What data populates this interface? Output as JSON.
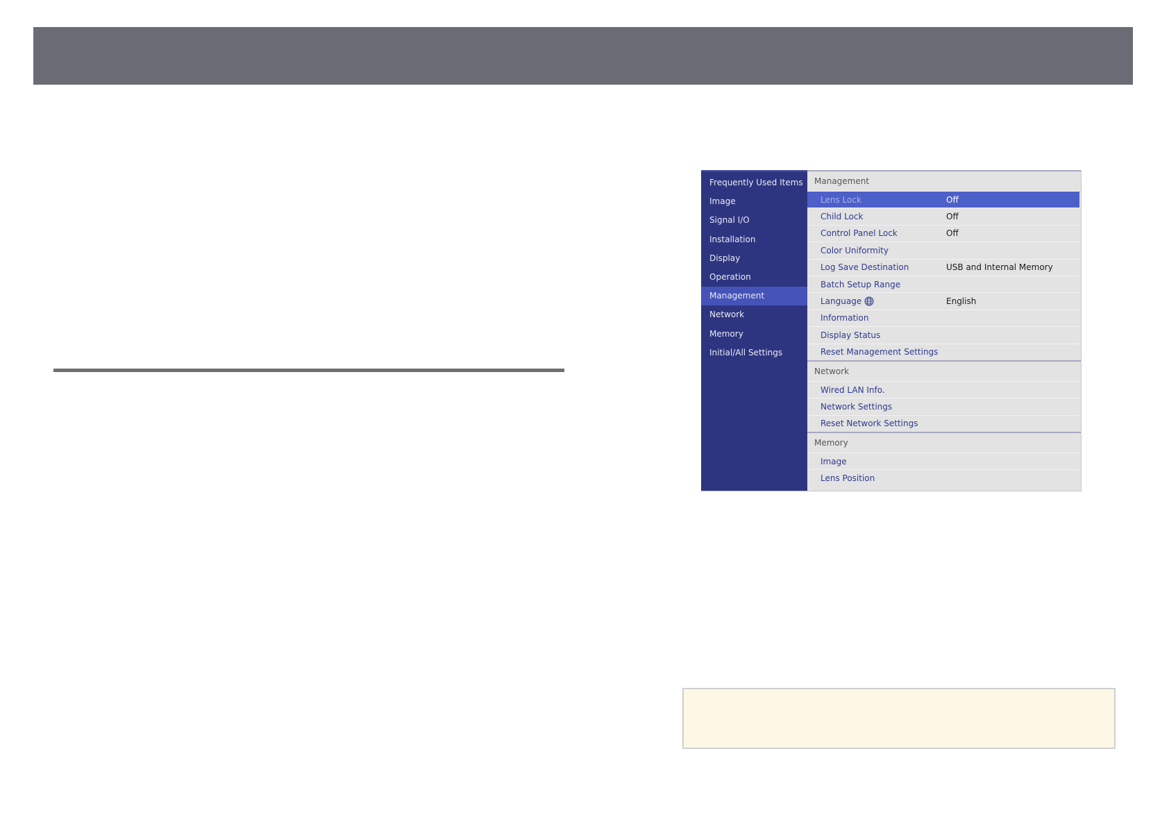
{
  "sidebar": {
    "items": [
      {
        "label": "Frequently Used Items"
      },
      {
        "label": "Image"
      },
      {
        "label": "Signal I/O"
      },
      {
        "label": "Installation"
      },
      {
        "label": "Display"
      },
      {
        "label": "Operation"
      },
      {
        "label": "Management"
      },
      {
        "label": "Network"
      },
      {
        "label": "Memory"
      },
      {
        "label": "Initial/All Settings"
      }
    ],
    "active": "Management"
  },
  "management": {
    "heading": "Management",
    "rows": [
      {
        "label": "Lens Lock",
        "value": "Off"
      },
      {
        "label": "Child Lock",
        "value": "Off"
      },
      {
        "label": "Control Panel Lock",
        "value": "Off"
      },
      {
        "label": "Color Uniformity",
        "value": ""
      },
      {
        "label": "Log Save Destination",
        "value": "USB and Internal Memory"
      },
      {
        "label": "Batch Setup Range",
        "value": ""
      },
      {
        "label": "Language",
        "value": "English",
        "icon": "globe-icon"
      },
      {
        "label": "Information",
        "value": ""
      },
      {
        "label": "Display Status",
        "value": ""
      },
      {
        "label": "Reset Management Settings",
        "value": ""
      }
    ],
    "selected": "Lens Lock"
  },
  "network": {
    "heading": "Network",
    "rows": [
      {
        "label": "Wired LAN Info."
      },
      {
        "label": "Network Settings"
      },
      {
        "label": "Reset Network Settings"
      }
    ]
  },
  "memory": {
    "heading": "Memory",
    "rows": [
      {
        "label": "Image"
      },
      {
        "label": "Lens Position"
      }
    ]
  },
  "colors": {
    "header_bar": "#696c75",
    "sidebar_bg": "#2e3580",
    "sidebar_active": "#4553b8",
    "selected_row": "#4d5fc8",
    "menu_bg": "#e3e3e3",
    "item_text": "#2e3a8f",
    "note_bg": "#fdf8e6"
  }
}
